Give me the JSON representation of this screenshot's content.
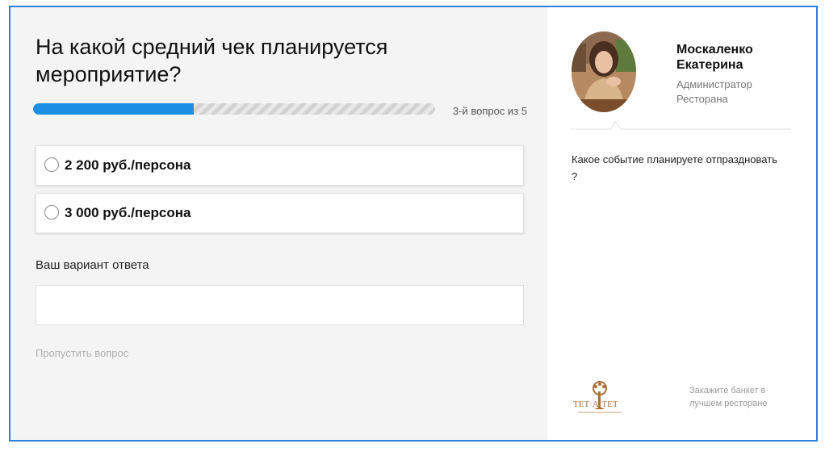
{
  "quiz": {
    "question": "На какой средний чек планируется мероприятие?",
    "progress": {
      "fraction": 0.4,
      "text": "3-й вопрос из 5"
    },
    "options": [
      {
        "label": "2 200 руб./персона"
      },
      {
        "label": "3 000 руб./персона"
      }
    ],
    "custom_answer": {
      "label": "Ваш вариант ответа",
      "value": "",
      "placeholder": ""
    },
    "skip_label": "Пропустить вопрос"
  },
  "manager": {
    "name": "Москаленко Екатерина",
    "role": "Администратор Ресторана",
    "hint": "Какое событие планируете отпраздновать ?"
  },
  "footer": {
    "logo_text": "ТЕТ·А·ТЕТ",
    "promo": "Закажите банкет в лучшем ресторане"
  },
  "colors": {
    "accent": "#1a8fe3",
    "frame": "#2e7fd9",
    "panel_bg": "#f4f4f4"
  }
}
